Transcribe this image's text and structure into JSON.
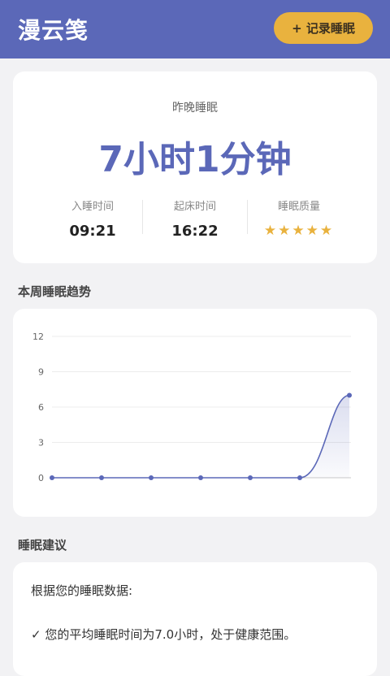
{
  "header": {
    "app_title": "漫云笺",
    "record_button": "+ 记录睡眠",
    "background": "#5b68b8",
    "button_color": "#e9b23e"
  },
  "summary": {
    "label": "昨晚睡眠",
    "duration": "7小时1分钟",
    "bedtime_label": "入睡时间",
    "bedtime_value": "09:21",
    "waketime_label": "起床时间",
    "waketime_value": "16:22",
    "quality_label": "睡眠质量",
    "quality_stars": "★★★★★",
    "quality_rating": 5
  },
  "trend_section": {
    "title": "本周睡眠趋势"
  },
  "chart_data": {
    "type": "area",
    "x": [
      1,
      2,
      3,
      4,
      5,
      6,
      7
    ],
    "series": [
      {
        "values": [
          0,
          0,
          0,
          0,
          0,
          0,
          7.0
        ]
      }
    ],
    "ylim": [
      0,
      12
    ],
    "yticks": [
      "12",
      "9",
      "6",
      "3",
      "0"
    ],
    "grid": true,
    "line_color": "#5b68b8"
  },
  "advice_section": {
    "title": "睡眠建议",
    "intro": "根据您的睡眠数据:",
    "line1": "✓ 您的平均睡眠时间为7.0小时，处于健康范围。"
  }
}
